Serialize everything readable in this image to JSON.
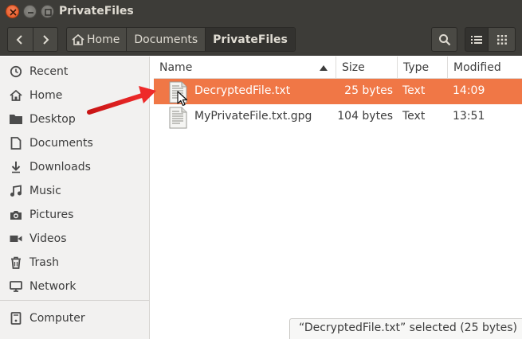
{
  "window": {
    "title": "PrivateFiles"
  },
  "toolbar": {
    "back_icon": "chevron-left-icon",
    "forward_icon": "chevron-right-icon",
    "breadcrumbs": [
      {
        "label": "Home",
        "icon": "home-icon"
      },
      {
        "label": "Documents"
      },
      {
        "label": "PrivateFiles",
        "active": true
      }
    ],
    "search_icon": "search-icon",
    "list_view_icon": "list-view-icon",
    "grid_view_icon": "grid-view-icon"
  },
  "sidebar": {
    "items": [
      {
        "label": "Recent",
        "icon": "clock-icon"
      },
      {
        "label": "Home",
        "icon": "home-icon"
      },
      {
        "label": "Desktop",
        "icon": "folder-icon"
      },
      {
        "label": "Documents",
        "icon": "document-icon"
      },
      {
        "label": "Downloads",
        "icon": "download-icon"
      },
      {
        "label": "Music",
        "icon": "music-icon"
      },
      {
        "label": "Pictures",
        "icon": "camera-icon"
      },
      {
        "label": "Videos",
        "icon": "video-icon"
      },
      {
        "label": "Trash",
        "icon": "trash-icon"
      },
      {
        "label": "Network",
        "icon": "network-icon"
      },
      {
        "label": "Computer",
        "icon": "computer-icon"
      }
    ]
  },
  "file_list": {
    "columns": {
      "name": "Name",
      "size": "Size",
      "type": "Type",
      "modified": "Modified"
    },
    "sort_indicator": "sort-ascending-icon",
    "rows": [
      {
        "name": "DecryptedFile.txt",
        "size": "25 bytes",
        "type": "Text",
        "modified": "14:09",
        "selected": true
      },
      {
        "name": "MyPrivateFile.txt.gpg",
        "size": "104 bytes",
        "type": "Text",
        "modified": "13:51",
        "selected": false
      }
    ]
  },
  "status": {
    "text": "“DecryptedFile.txt” selected  (25 bytes)"
  },
  "colors": {
    "selection": "#f07746",
    "titlebar": "#3d3c38",
    "sidebar": "#f2f1f0",
    "annotation_arrow": "#e02020"
  }
}
